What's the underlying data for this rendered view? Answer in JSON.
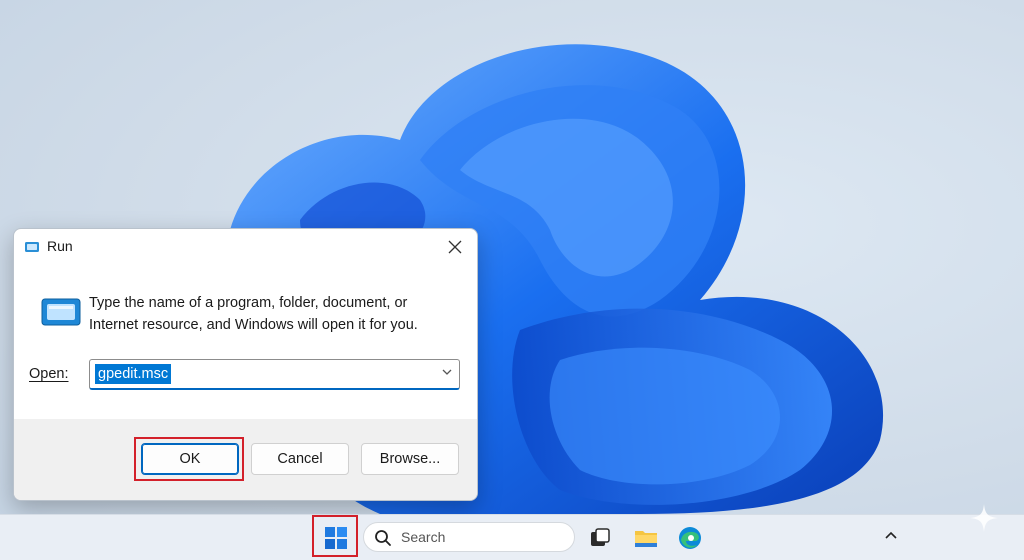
{
  "dialog": {
    "title": "Run",
    "description_line1": "Type the name of a program, folder, document, or",
    "description_line2": "Internet resource, and Windows will open it for you.",
    "open_label": "Open:",
    "open_value": "gpedit.msc",
    "ok_label": "OK",
    "cancel_label": "Cancel",
    "browse_label": "Browse..."
  },
  "taskbar": {
    "search_placeholder": "Search",
    "icons": [
      "start-icon",
      "search-icon",
      "task-view-icon",
      "file-explorer-icon",
      "edge-icon",
      "chevron-up-icon"
    ]
  },
  "colors": {
    "highlight_red": "#d3202a",
    "accent_blue": "#0078d4"
  }
}
